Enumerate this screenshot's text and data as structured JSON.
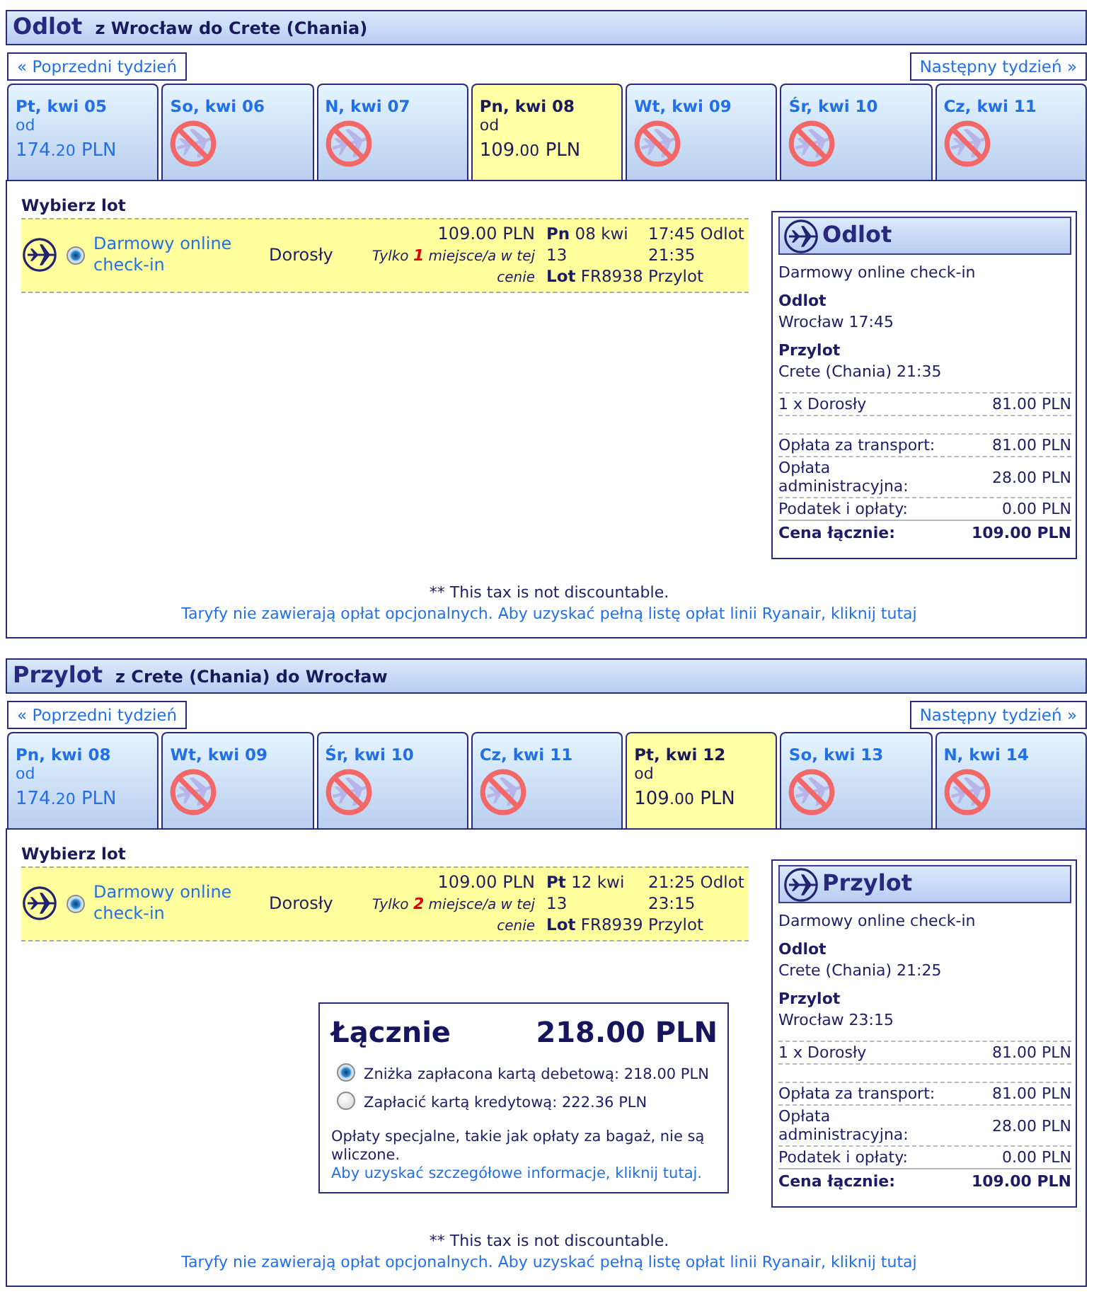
{
  "sections": [
    {
      "title": "Odlot",
      "route": "z Wrocław do Crete (Chania)",
      "prev_week": "« Poprzedni tydzień",
      "next_week": "Następny tydzień »",
      "days": [
        {
          "label": "Pt, kwi 05",
          "available": true,
          "selected": false,
          "from": "od",
          "amount": "174",
          "fraction": ".20",
          "currency": "PLN"
        },
        {
          "label": "So, kwi 06",
          "available": false,
          "selected": false
        },
        {
          "label": "N, kwi 07",
          "available": false,
          "selected": false
        },
        {
          "label": "Pn, kwi 08",
          "available": true,
          "selected": true,
          "from": "od",
          "amount": "109",
          "fraction": ".00",
          "currency": "PLN"
        },
        {
          "label": "Wt, kwi 09",
          "available": false,
          "selected": false
        },
        {
          "label": "Śr, kwi 10",
          "available": false,
          "selected": false
        },
        {
          "label": "Cz, kwi 11",
          "available": false,
          "selected": false
        }
      ],
      "flights_heading": "Wybierz lot",
      "flights": [
        {
          "selected": true,
          "fare": "Darmowy online check-in",
          "passenger": "Dorosły",
          "price": "109.00 PLN",
          "seats_note": "Tylko **1** miejsce/a w tej cenie",
          "date": "**Pn** 08 kwi 13",
          "flight": "**Lot** FR8938",
          "departure": "17:45 Odlot",
          "arrival": "21:35 Przylot"
        }
      ],
      "summary": {
        "title": "Odlot",
        "fare": "Darmowy online check-in",
        "departure_label": "Odlot",
        "departure": "Wrocław 17:45",
        "arrival_label": "Przylot",
        "arrival": "Crete (Chania) 21:35",
        "passengers": [
          {
            "label": "1 x Dorosły",
            "amount": "81.00 PLN"
          }
        ],
        "charges": [
          {
            "label": "Opłata za transport:",
            "amount": "81.00 PLN"
          },
          {
            "label": "Opłata administracyjna:",
            "amount": "28.00 PLN"
          },
          {
            "label": "Podatek i opłaty:",
            "amount": "0.00 PLN"
          }
        ],
        "total_label": "Cena łącznie:",
        "total_amount": "109.00 PLN"
      },
      "tax_note": "** This tax is not discountable.",
      "fees_link": "Taryfy nie zawierają opłat opcjonalnych. Aby uzyskać pełną listę opłat linii Ryanair, kliknij tutaj"
    },
    {
      "title": "Przylot",
      "route": "z Crete (Chania) do Wrocław",
      "prev_week": "« Poprzedni tydzień",
      "next_week": "Następny tydzień »",
      "days": [
        {
          "label": "Pn, kwi 08",
          "available": true,
          "selected": false,
          "from": "od",
          "amount": "174",
          "fraction": ".20",
          "currency": "PLN"
        },
        {
          "label": "Wt, kwi 09",
          "available": false,
          "selected": false
        },
        {
          "label": "Śr, kwi 10",
          "available": false,
          "selected": false
        },
        {
          "label": "Cz, kwi 11",
          "available": false,
          "selected": false
        },
        {
          "label": "Pt, kwi 12",
          "available": true,
          "selected": true,
          "from": "od",
          "amount": "109",
          "fraction": ".00",
          "currency": "PLN"
        },
        {
          "label": "So, kwi 13",
          "available": false,
          "selected": false
        },
        {
          "label": "N, kwi 14",
          "available": false,
          "selected": false
        }
      ],
      "flights_heading": "Wybierz lot",
      "flights": [
        {
          "selected": true,
          "fare": "Darmowy online check-in",
          "passenger": "Dorosły",
          "price": "109.00 PLN",
          "seats_note": "Tylko **2** miejsce/a w tej cenie",
          "date": "**Pt** 12 kwi 13",
          "flight": "**Lot** FR8939",
          "departure": "21:25 Odlot",
          "arrival": "23:15 Przylot"
        }
      ],
      "total": {
        "label": "Łącznie",
        "amount": "218.00 PLN",
        "payment_options": [
          {
            "selected": true,
            "text": "Zniżka zapłacona kartą debetową: 218.00 PLN"
          },
          {
            "selected": false,
            "text": "Zapłacić kartą kredytową: 222.36 PLN"
          }
        ],
        "note": "Opłaty specjalne, takie jak opłaty za bagaż, nie są wliczone.",
        "note_link": "Aby uzyskać szczegółowe informacje, kliknij tutaj."
      },
      "summary": {
        "title": "Przylot",
        "fare": "Darmowy online check-in",
        "departure_label": "Odlot",
        "departure": "Crete (Chania) 21:25",
        "arrival_label": "Przylot",
        "arrival": "Wrocław 23:15",
        "passengers": [
          {
            "label": "1 x Dorosły",
            "amount": "81.00 PLN"
          }
        ],
        "charges": [
          {
            "label": "Opłata za transport:",
            "amount": "81.00 PLN"
          },
          {
            "label": "Opłata administracyjna:",
            "amount": "28.00 PLN"
          },
          {
            "label": "Podatek i opłaty:",
            "amount": "0.00 PLN"
          }
        ],
        "total_label": "Cena łącznie:",
        "total_amount": "109.00 PLN"
      },
      "tax_note": "** This tax is not discountable.",
      "fees_link": "Taryfy nie zawierają opłat opcjonalnych. Aby uzyskać pełną listę opłat linii Ryanair, kliknij tutaj"
    }
  ]
}
